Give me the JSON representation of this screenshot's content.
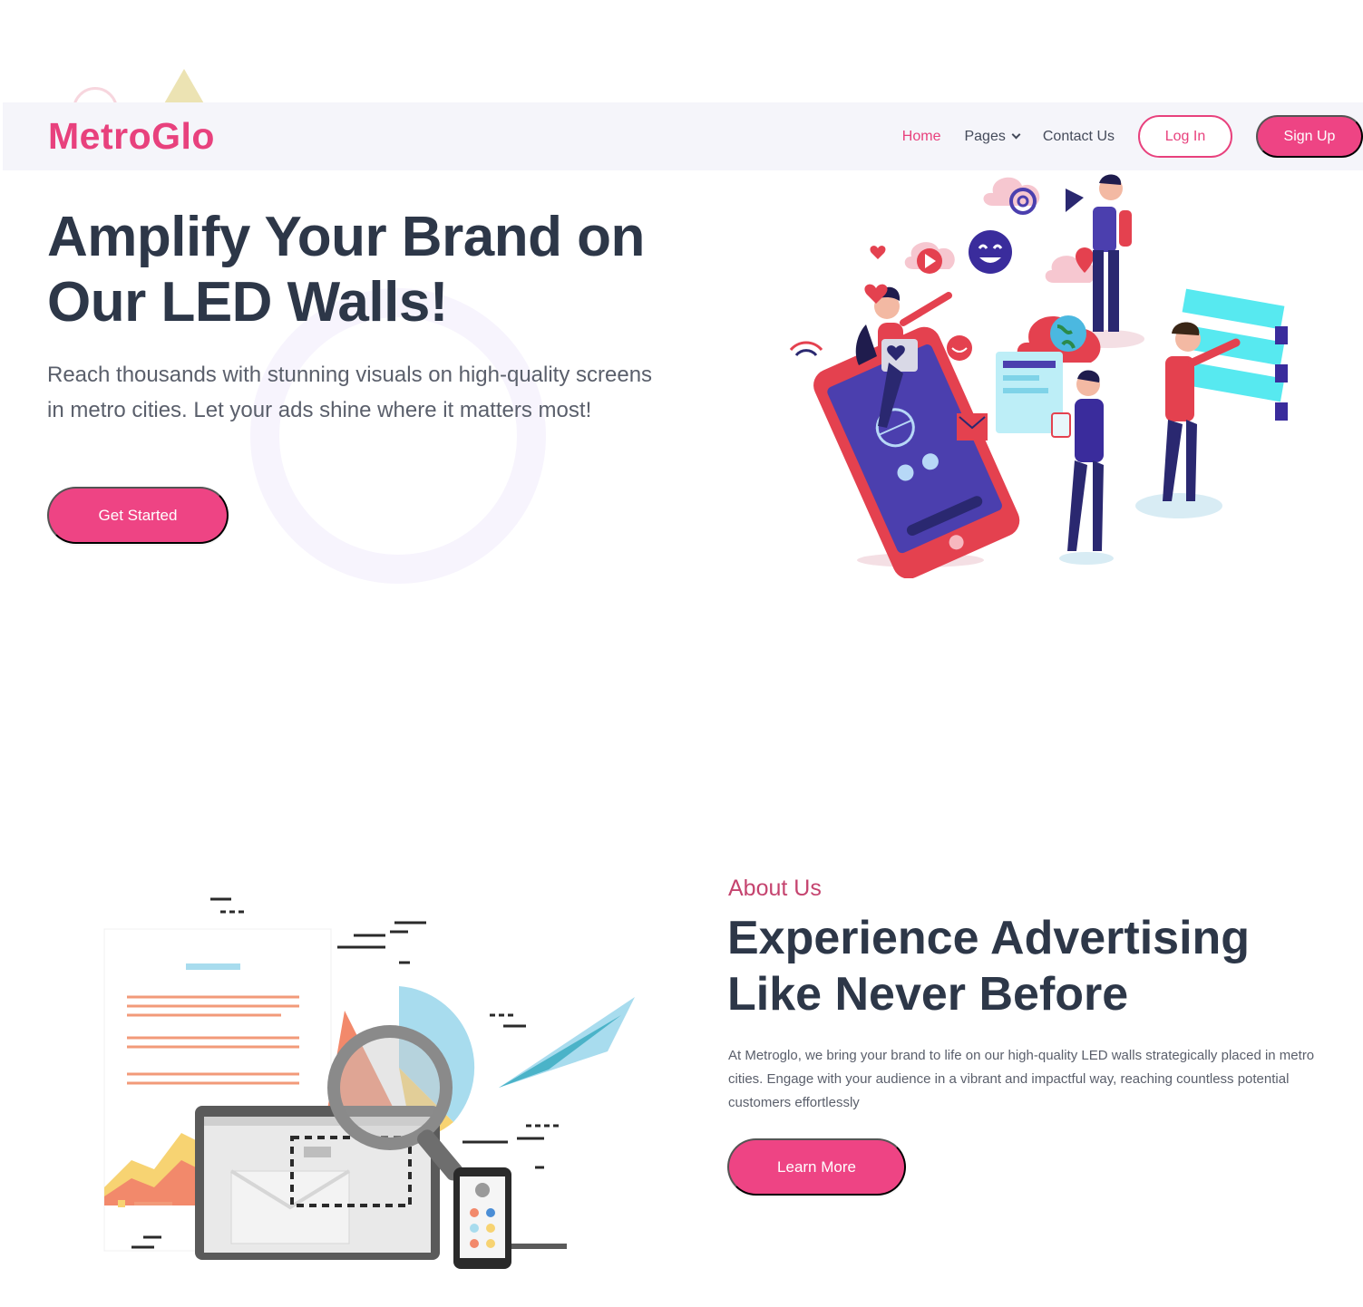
{
  "brand": {
    "name": "MetroGlo",
    "accent": "#ee4484",
    "logo_color": "#e8417d",
    "heading_color": "#2d3748"
  },
  "nav": {
    "home": "Home",
    "pages": "Pages",
    "contact": "Contact Us",
    "login": "Log In",
    "signup": "Sign Up"
  },
  "hero": {
    "title": "Amplify Your Brand on Our LED Walls!",
    "text": "Reach thousands with stunning visuals on high-quality screens in metro cities. Let your ads shine where it matters most!",
    "cta": "Get Started"
  },
  "about": {
    "eyebrow": "About Us",
    "title": "Experience Advertising Like Never Before",
    "text": "At Metroglo, we bring your brand to life on our high-quality LED walls strategically placed in metro cities. Engage with your audience in a vibrant and impactful way, reaching countless potential customers effortlessly",
    "cta": "Learn More"
  },
  "icons": {
    "dropdown": "chevron-down-icon",
    "hero_illustration": "digital-marketing-illustration",
    "about_illustration": "email-analytics-illustration"
  }
}
